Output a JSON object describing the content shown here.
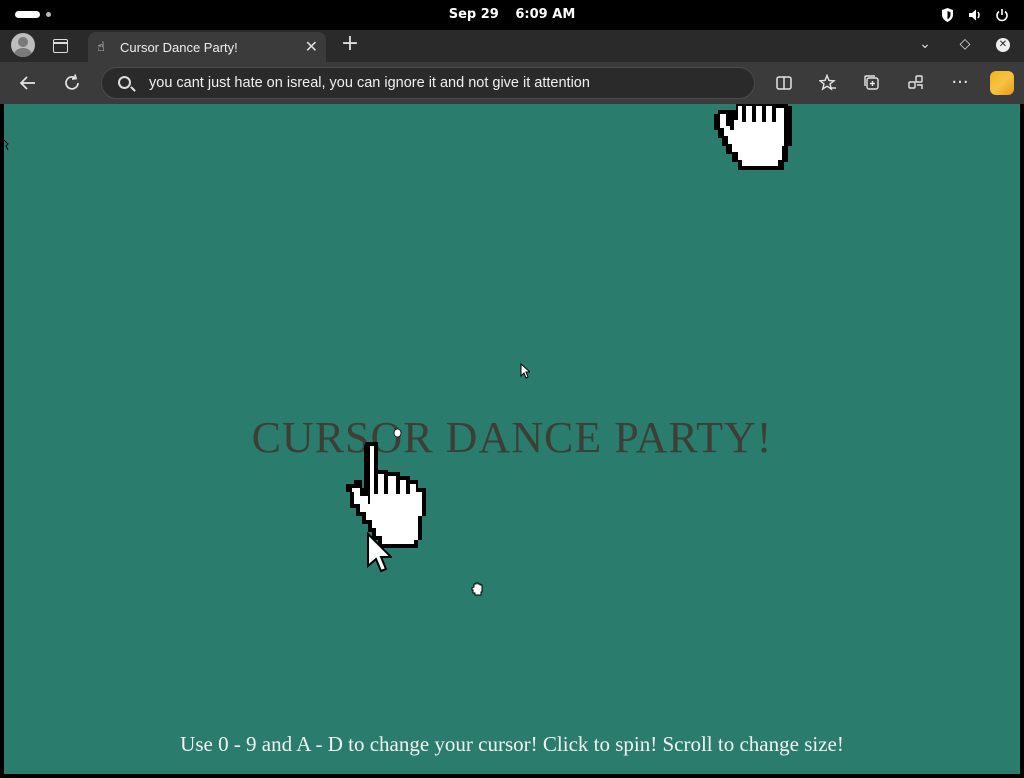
{
  "system_bar": {
    "date": "Sep 29",
    "time": "6:09 AM"
  },
  "browser": {
    "tab": {
      "title": "Cursor Dance Party!",
      "favicon": "hand-cursor-icon"
    },
    "address_bar": {
      "value": "you cant just hate on isreal, you can ignore it and not give it attention"
    },
    "toolbar_icons": [
      "back-icon",
      "reload-icon",
      "split-screen-icon",
      "favorites-icon",
      "collections-icon",
      "extensions-icon",
      "more-icon",
      "copilot-icon"
    ]
  },
  "page": {
    "title": "CURSOR DANCE PARTY!",
    "instructions": "Use 0 - 9 and A - D to change your cursor! Click to spin! Scroll to change size!",
    "background_color": "#2a7d6d",
    "title_color": "#3b3f36",
    "cursors": [
      "open-hand-cursor",
      "arrow-cursor",
      "pointing-hand-cursor",
      "arrow-cursor",
      "open-hand-cursor",
      "small-hand-cursor"
    ]
  }
}
